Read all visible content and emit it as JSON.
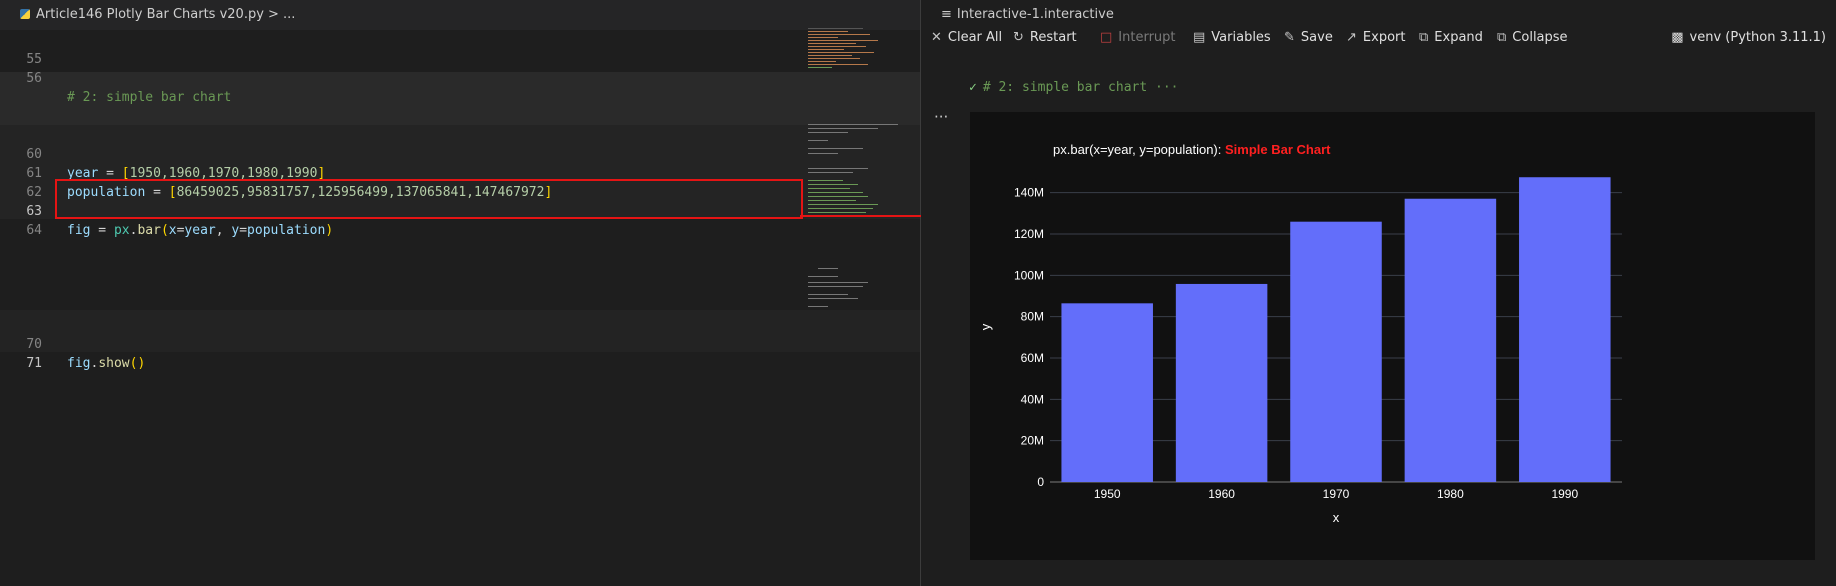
{
  "editor": {
    "breadcrumb_file": "Article146 Plotly Bar Charts v20.py",
    "breadcrumb_sep": ">",
    "breadcrumb_more": "...",
    "lines": {
      "l55": "55",
      "l56": "56",
      "l60": "60",
      "l61": "61",
      "l62": "62",
      "l63": "63",
      "l64": "64",
      "l70": "70",
      "l71": "71",
      "comment": "# 2: simple bar chart",
      "year_var": "year",
      "year_vals": "1950,1960,1970,1980,1990",
      "pop_var": "population",
      "pop_vals": "86459025,95831757,125956499,137065841,147467972",
      "fig_var": "fig",
      "px": "px",
      "bar": "bar",
      "x_arg": "x",
      "y_arg": "y",
      "year_ref": "year",
      "pop_ref": "population",
      "show": "show"
    }
  },
  "interactive": {
    "title": "Interactive-1.interactive",
    "toolbar": {
      "clear_all": "Clear All",
      "restart": "Restart",
      "interrupt": "Interrupt",
      "variables": "Variables",
      "save": "Save",
      "export": "Export",
      "expand": "Expand",
      "collapse": "Collapse"
    },
    "kernel": "venv (Python 3.11.1)",
    "cell_header": "# 2: simple bar chart ···",
    "cell_more": "···"
  },
  "colors": {
    "bar": "#636efa",
    "annotation_red": "#e51414",
    "title_red": "#ff2020"
  },
  "chart_data": {
    "type": "bar",
    "title_prefix": "px.bar(x=year, y=population): ",
    "title_highlight": "Simple Bar Chart",
    "categories": [
      "1950",
      "1960",
      "1970",
      "1980",
      "1990"
    ],
    "values": [
      86459025,
      95831757,
      125956499,
      137065841,
      147467972
    ],
    "xlabel": "x",
    "ylabel": "y",
    "ylim": [
      0,
      150000000
    ],
    "yticks": [
      0,
      20000000,
      40000000,
      60000000,
      80000000,
      100000000,
      120000000,
      140000000
    ],
    "ytick_labels": [
      "0",
      "20M",
      "40M",
      "60M",
      "80M",
      "100M",
      "120M",
      "140M"
    ],
    "grid": true,
    "legend": "none"
  }
}
